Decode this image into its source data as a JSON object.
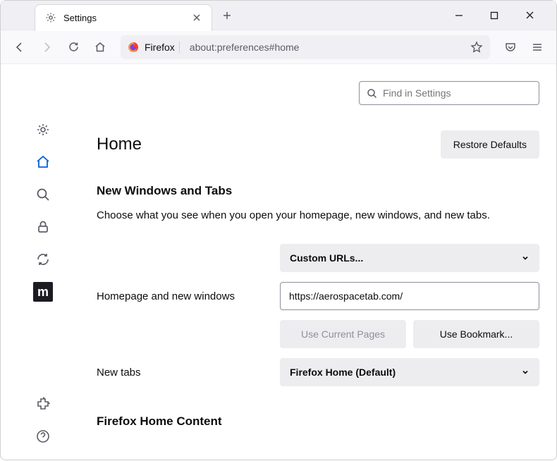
{
  "tab": {
    "title": "Settings"
  },
  "urlbar": {
    "label": "Firefox",
    "url": "about:preferences#home"
  },
  "search": {
    "placeholder": "Find in Settings"
  },
  "page": {
    "heading": "Home",
    "restore_button": "Restore Defaults",
    "section_title": "New Windows and Tabs",
    "description": "Choose what you see when you open your homepage, new windows, and new tabs.",
    "homepage_label": "Homepage and new windows",
    "homepage_select": "Custom URLs...",
    "homepage_url": "https://aerospacetab.com/",
    "use_current": "Use Current Pages",
    "use_bookmark": "Use Bookmark...",
    "newtabs_label": "New tabs",
    "newtabs_select": "Firefox Home (Default)",
    "content_section": "Firefox Home Content"
  },
  "nav": {
    "general": "general",
    "home": "home",
    "search": "search",
    "privacy": "privacy",
    "sync": "sync",
    "m_icon": "m",
    "extensions": "extensions",
    "help": "help"
  }
}
